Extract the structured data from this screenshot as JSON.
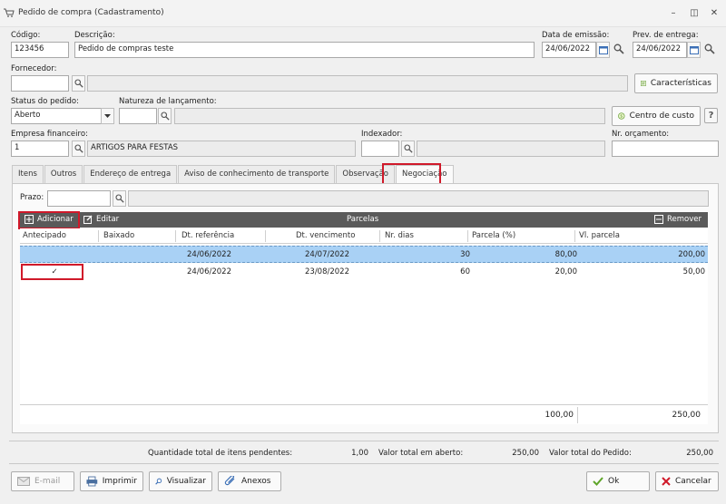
{
  "window": {
    "title": "Pedido de compra (Cadastramento)"
  },
  "header": {
    "codigo_label": "Código:",
    "codigo_value": "123456",
    "descricao_label": "Descrição:",
    "descricao_value": "Pedido de compras teste",
    "data_emissao_label": "Data de emissão:",
    "data_emissao_value": "24/06/2022",
    "prev_entrega_label": "Prev. de entrega:",
    "prev_entrega_value": "24/06/2022",
    "fornecedor_label": "Fornecedor:",
    "fornecedor_value": "",
    "fornecedor_nome": "",
    "caracteristicas_label": "Características",
    "status_label": "Status do pedido:",
    "status_value": "Aberto",
    "natureza_label": "Natureza de lançamento:",
    "natureza_value": "",
    "natureza_nome": "",
    "centro_custo_label": "Centro de custo",
    "empresa_label": "Empresa financeiro:",
    "empresa_value": "1",
    "empresa_nome": "ARTIGOS PARA FESTAS",
    "indexador_label": "Indexador:",
    "indexador_value": "",
    "indexador_nome": "",
    "orcamento_label": "Nr. orçamento:",
    "orcamento_value": ""
  },
  "tabs": [
    "Itens",
    "Outros",
    "Endereço de entrega",
    "Aviso de conhecimento de transporte",
    "Observação",
    "Negociação"
  ],
  "active_tab": "Negociação",
  "negociacao": {
    "prazo_label": "Prazo:",
    "prazo_value": "",
    "prazo_nome": "",
    "toolbar": {
      "adicionar": "Adicionar",
      "editar": "Editar",
      "title": "Parcelas",
      "remover": "Remover"
    },
    "columns": [
      "Antecipado",
      "Baixado",
      "Dt. referência",
      "Dt. vencimento",
      "Nr. dias",
      "Parcela (%)",
      "Vl. parcela"
    ],
    "rows": [
      {
        "antecipado": "",
        "baixado": "",
        "dt_referencia": "24/06/2022",
        "dt_vencimento": "24/07/2022",
        "nr_dias": "30",
        "parcela_pct": "80,00",
        "vl_parcela": "200,00",
        "selected": true
      },
      {
        "antecipado": "✓",
        "baixado": "",
        "dt_referencia": "24/06/2022",
        "dt_vencimento": "23/08/2022",
        "nr_dias": "60",
        "parcela_pct": "20,00",
        "vl_parcela": "50,00",
        "selected": false
      }
    ],
    "total_pct": "100,00",
    "total_valor": "250,00"
  },
  "summary": {
    "qtd_label": "Quantidade total de itens pendentes:",
    "qtd_value": "1,00",
    "valor_aberto_label": "Valor total em aberto:",
    "valor_aberto_value": "250,00",
    "valor_pedido_label": "Valor total do Pedido:",
    "valor_pedido_value": "250,00"
  },
  "buttons": {
    "email": "E-mail",
    "imprimir": "Imprimir",
    "visualizar": "Visualizar",
    "anexos": "Anexos",
    "ok": "Ok",
    "cancelar": "Cancelar"
  },
  "colors": {
    "selected_row": "#a9d1f5",
    "highlight": "#d0192a",
    "grid_toolbar": "#5a5a5a"
  }
}
